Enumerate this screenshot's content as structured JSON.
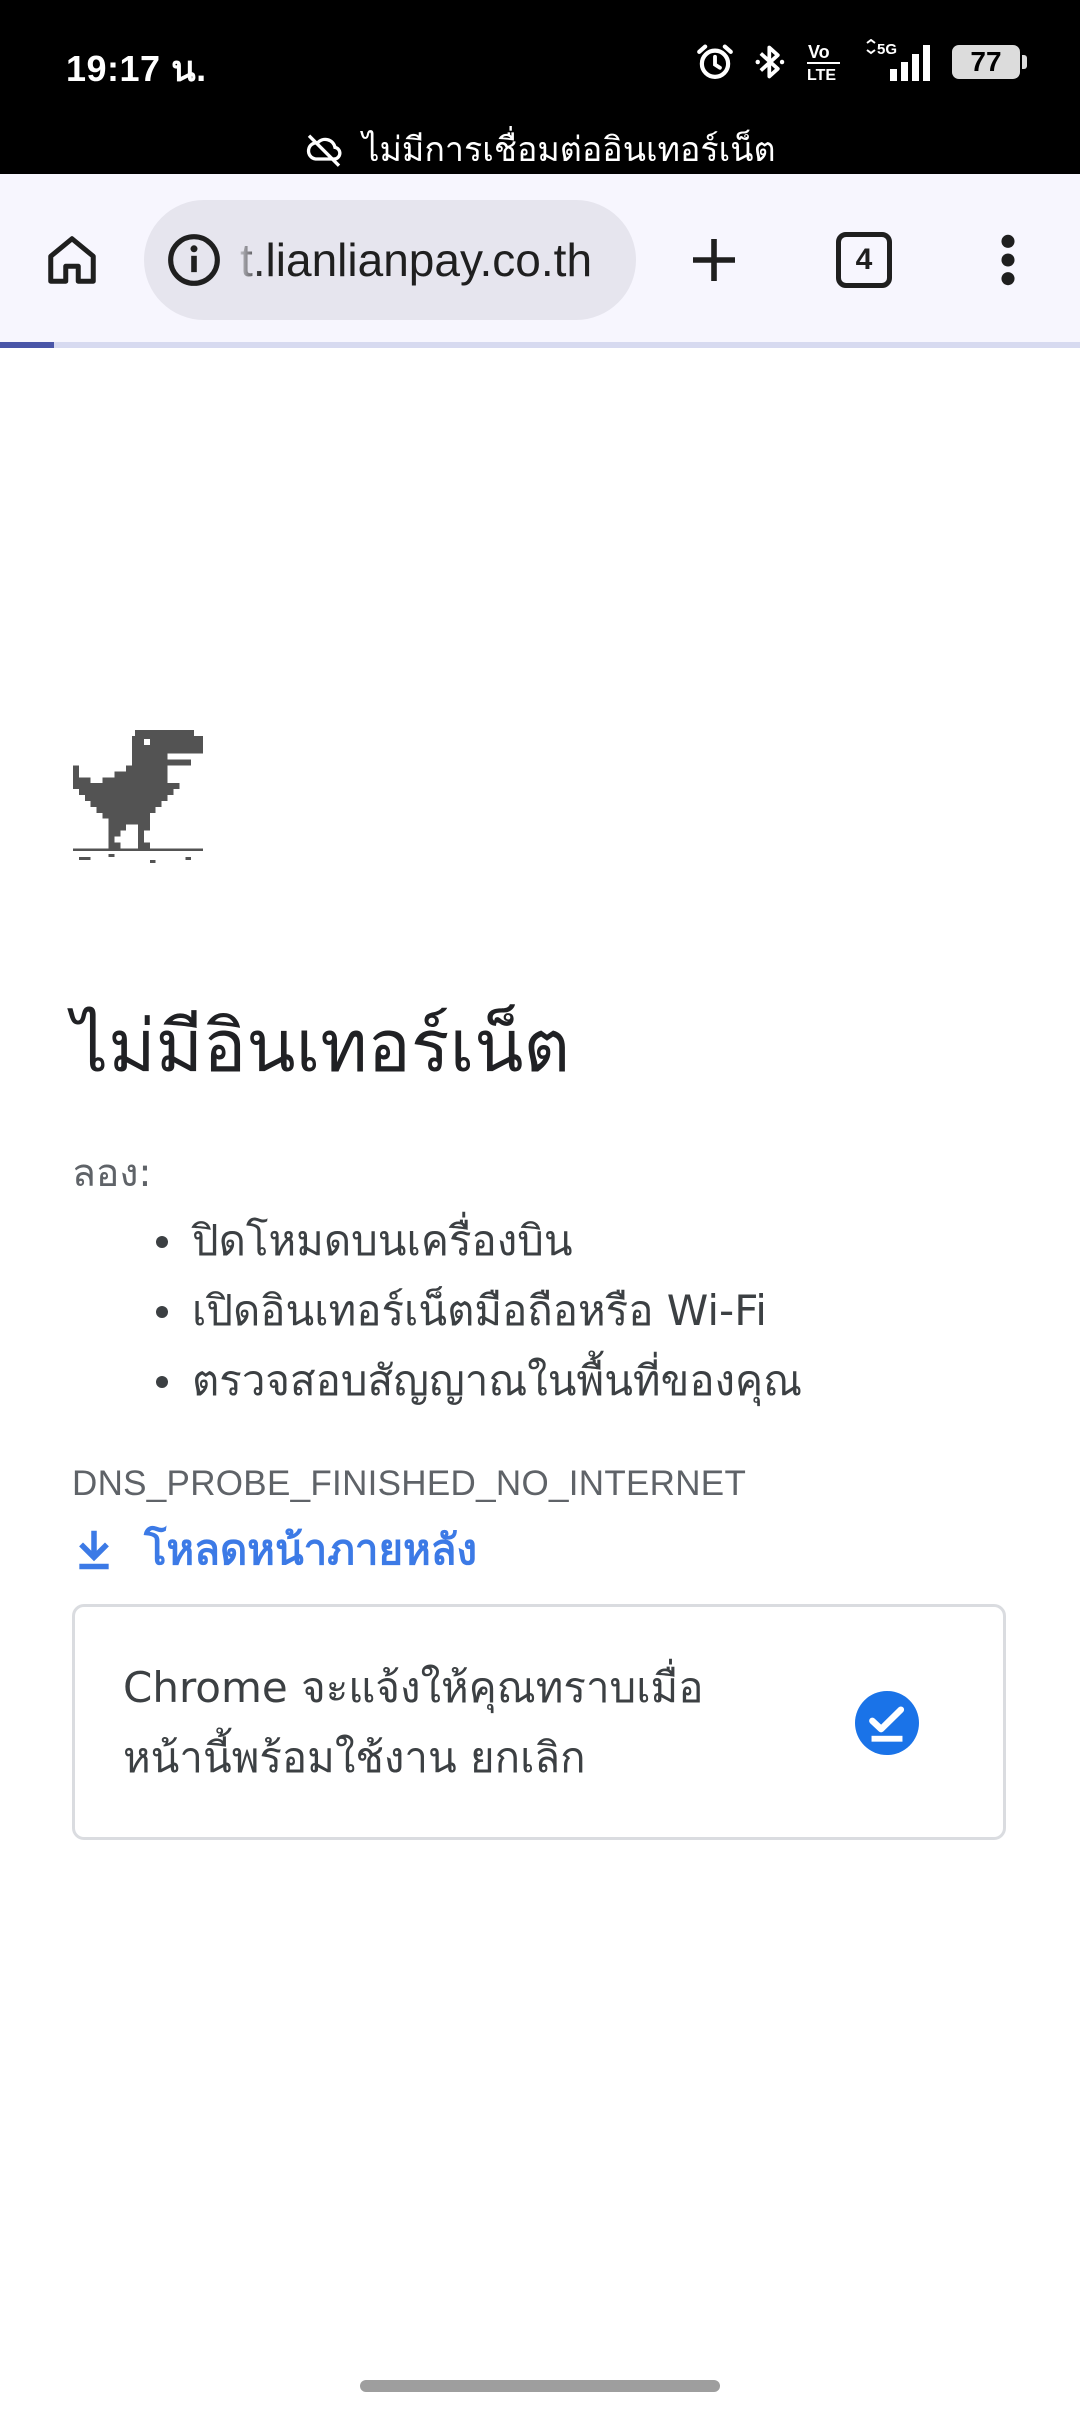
{
  "status_bar": {
    "time": "19:17 น.",
    "battery_level": "77",
    "network_label": "5G"
  },
  "offline_banner": {
    "text": "ไม่มีการเชื่อมต่ออินเทอร์เน็ต"
  },
  "toolbar": {
    "url": "t.lianlianpay.co.th",
    "tab_count": "4",
    "page_load_progress": 0.05
  },
  "error_page": {
    "heading": "ไม่มีอินเทอร์เน็ต",
    "try_label": "ลอง:",
    "suggestions": [
      "ปิดโหมดบนเครื่องบิน",
      "เปิดอินเทอร์เน็ตมือถือหรือ Wi-Fi",
      "ตรวจสอบสัญญาณในพื้นที่ของคุณ"
    ],
    "error_code": "DNS_PROBE_FINISHED_NO_INTERNET",
    "download_later_label": "โหลดหน้าภายหลัง",
    "notify_line1": "Chrome จะแจ้งให้คุณทราบเมื่อ",
    "notify_line2": "หน้านี้พร้อมใช้งาน",
    "notify_cancel": "ยกเลิก"
  },
  "colors": {
    "accent_blue": "#1a73e8",
    "link_blue": "#3c7ae6",
    "progress": "#4a56a8"
  },
  "icons": {
    "status": [
      "alarm-icon",
      "bluetooth-icon",
      "volte-icon",
      "mobile-signal-icon",
      "battery-icon"
    ],
    "banner": "cloud-off-icon",
    "toolbar": [
      "home-icon",
      "info-icon",
      "plus-icon",
      "tab-switcher-icon",
      "more-vert-icon"
    ],
    "content": [
      "dino-icon",
      "download-icon",
      "check-circle-icon"
    ]
  }
}
